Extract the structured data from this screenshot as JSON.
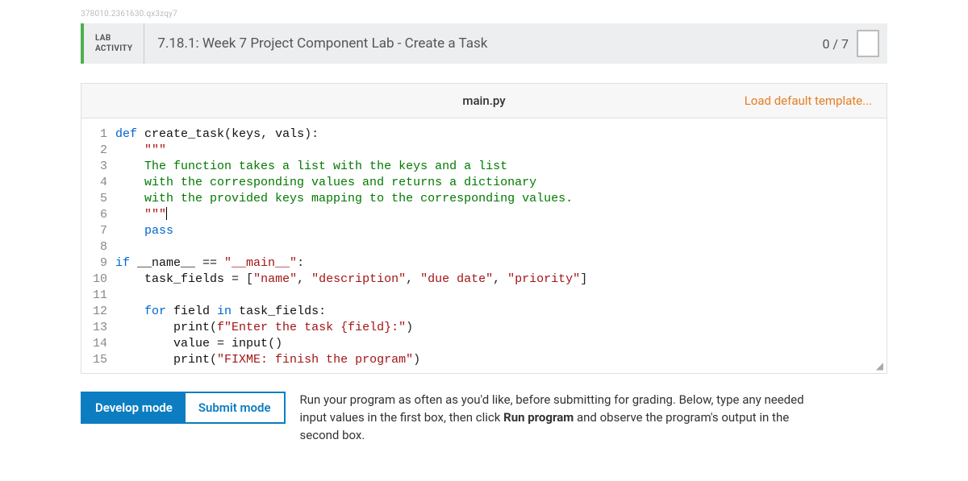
{
  "watermark": "378010.2361630.qx3zqy7",
  "header": {
    "badge_line1": "LAB",
    "badge_line2": "ACTIVITY",
    "title": "7.18.1: Week 7 Project Component Lab - Create a Task",
    "score": "0 / 7"
  },
  "filebar": {
    "filename": "main.py",
    "load_template": "Load default template..."
  },
  "code": {
    "lines": [
      {
        "n": "1",
        "tokens": [
          [
            "kw",
            "def "
          ],
          [
            "fn",
            "create_task"
          ],
          [
            "op",
            "("
          ],
          [
            "fn",
            "keys"
          ],
          [
            "op",
            ", "
          ],
          [
            "fn",
            "vals"
          ],
          [
            "op",
            "):"
          ]
        ]
      },
      {
        "n": "2",
        "tokens": [
          [
            "op",
            "    "
          ],
          [
            "str",
            "\"\"\""
          ]
        ]
      },
      {
        "n": "3",
        "tokens": [
          [
            "op",
            "    "
          ],
          [
            "comm",
            "The function takes a list with the keys and a list"
          ]
        ]
      },
      {
        "n": "4",
        "tokens": [
          [
            "op",
            "    "
          ],
          [
            "comm",
            "with the corresponding values and returns a dictionary"
          ]
        ]
      },
      {
        "n": "5",
        "tokens": [
          [
            "op",
            "    "
          ],
          [
            "comm",
            "with the provided keys mapping to the corresponding values."
          ]
        ]
      },
      {
        "n": "6",
        "tokens": [
          [
            "op",
            "    "
          ],
          [
            "str",
            "\"\"\""
          ]
        ],
        "cursor": true
      },
      {
        "n": "7",
        "tokens": [
          [
            "op",
            "    "
          ],
          [
            "kw",
            "pass"
          ]
        ]
      },
      {
        "n": "8",
        "tokens": [
          [
            "op",
            ""
          ]
        ]
      },
      {
        "n": "9",
        "tokens": [
          [
            "kw",
            "if "
          ],
          [
            "fn",
            "__name__"
          ],
          [
            "op",
            " == "
          ],
          [
            "str",
            "\"__main__\""
          ],
          [
            "op",
            ":"
          ]
        ]
      },
      {
        "n": "10",
        "tokens": [
          [
            "op",
            "    "
          ],
          [
            "fn",
            "task_fields"
          ],
          [
            "op",
            " = ["
          ],
          [
            "str",
            "\"name\""
          ],
          [
            "op",
            ", "
          ],
          [
            "str",
            "\"description\""
          ],
          [
            "op",
            ", "
          ],
          [
            "str",
            "\"due date\""
          ],
          [
            "op",
            ", "
          ],
          [
            "str",
            "\"priority\""
          ],
          [
            "op",
            "]"
          ]
        ]
      },
      {
        "n": "11",
        "tokens": [
          [
            "op",
            ""
          ]
        ]
      },
      {
        "n": "12",
        "tokens": [
          [
            "op",
            "    "
          ],
          [
            "kw",
            "for "
          ],
          [
            "fn",
            "field"
          ],
          [
            "kw",
            " in "
          ],
          [
            "fn",
            "task_fields"
          ],
          [
            "op",
            ":"
          ]
        ]
      },
      {
        "n": "13",
        "tokens": [
          [
            "op",
            "        "
          ],
          [
            "fn",
            "print"
          ],
          [
            "op",
            "("
          ],
          [
            "str",
            "f\"Enter the task {field}:\""
          ],
          [
            "op",
            ")"
          ]
        ]
      },
      {
        "n": "14",
        "tokens": [
          [
            "op",
            "        "
          ],
          [
            "fn",
            "value"
          ],
          [
            "op",
            " = "
          ],
          [
            "fn",
            "input"
          ],
          [
            "op",
            "()"
          ]
        ]
      },
      {
        "n": "15",
        "tokens": [
          [
            "op",
            "        "
          ],
          [
            "fn",
            "print"
          ],
          [
            "op",
            "("
          ],
          [
            "str",
            "\"FIXME: finish the program\""
          ],
          [
            "op",
            ")"
          ]
        ]
      }
    ]
  },
  "modes": {
    "develop": "Develop mode",
    "submit": "Submit mode"
  },
  "helper": {
    "line1a": "Run your program as often as you'd like, before submitting for grading. Below, type any needed",
    "line2a": "input values in the first box, then click ",
    "line2b": "Run program",
    "line2c": " and observe the program's output in the",
    "line3": "second box."
  }
}
